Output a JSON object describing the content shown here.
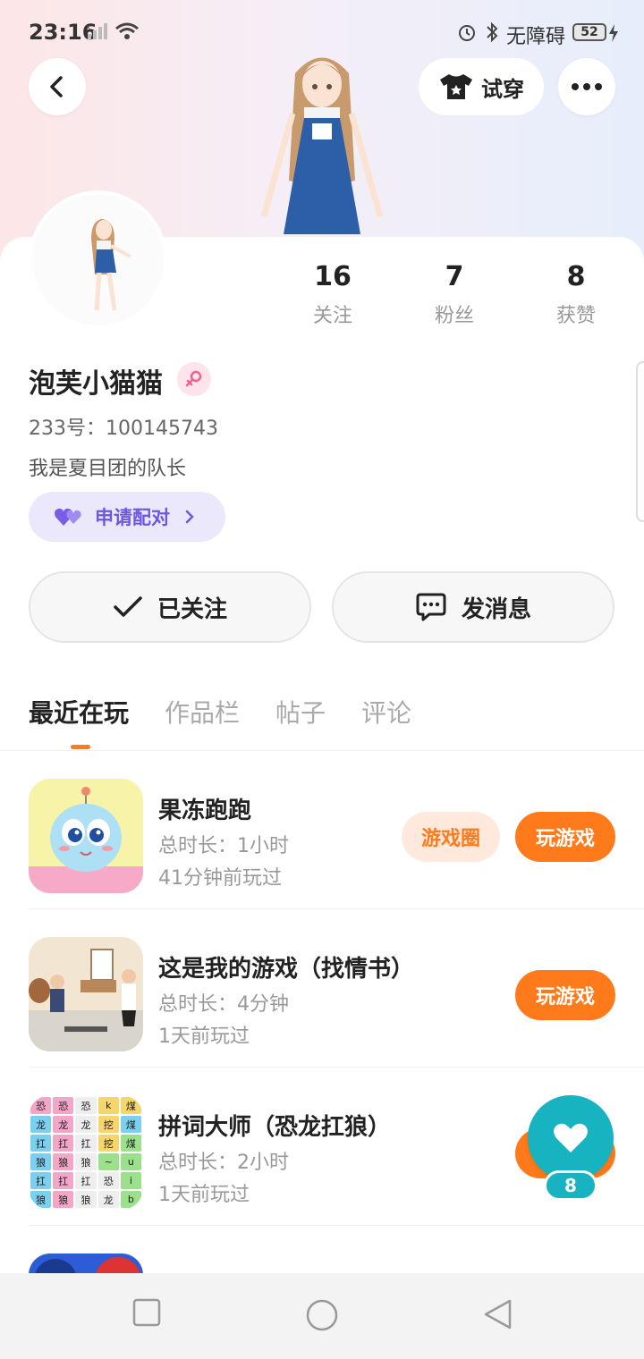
{
  "status_bar": {
    "time": "23:16",
    "accessibility": "无障碍",
    "battery": "52"
  },
  "header": {
    "try_on_label": "试穿",
    "icons": [
      "back-arrow-icon",
      "tshirt-icon",
      "more-dots-icon"
    ]
  },
  "profile": {
    "username": "泡芙小猫猫",
    "gender": "female",
    "uid": "233号：100145743",
    "bio": "我是夏目团的队长",
    "pair_label": "申请配对",
    "stats": [
      {
        "num": "16",
        "label": "关注"
      },
      {
        "num": "7",
        "label": "粉丝"
      },
      {
        "num": "8",
        "label": "获赞"
      }
    ]
  },
  "actions": {
    "follow_label": "已关注",
    "message_label": "发消息"
  },
  "tabs": [
    "最近在玩",
    "作品栏",
    "帖子",
    "评论"
  ],
  "games": [
    {
      "name": "果冻跑跑",
      "duration": "总时长：1小时",
      "last_played": "41分钟前玩过",
      "circle_label": "游戏圈",
      "play_label": "玩游戏"
    },
    {
      "name": "这是我的游戏（找情书）",
      "duration": "总时长：4分钟",
      "last_played": "1天前玩过",
      "play_label": "玩游戏"
    },
    {
      "name": "拼词大师（恐龙扛狼）",
      "duration": "总时长：2小时",
      "last_played": "1天前玩过",
      "play_label": "玩游戏"
    }
  ],
  "word_tiles": [
    "恐",
    "恐",
    "恐",
    "k",
    "煤",
    "龙",
    "龙",
    "龙",
    "挖",
    "煤",
    "扛",
    "扛",
    "扛",
    "挖",
    "煤",
    "狼",
    "狼",
    "狼",
    "~",
    "u",
    "扛",
    "扛",
    "扛",
    "恐",
    "i",
    "狼",
    "狼",
    "狼",
    "龙",
    "b"
  ],
  "floating_like": {
    "count": "8"
  },
  "colors": {
    "accent": "#ff7a1a",
    "pair": "#6d57e0",
    "like": "#17b3c1"
  }
}
